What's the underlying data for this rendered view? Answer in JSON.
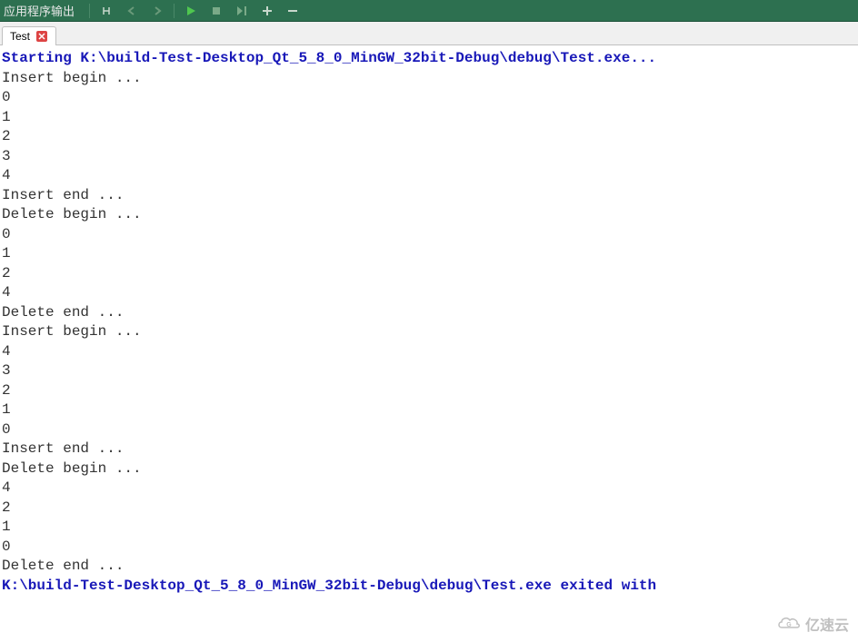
{
  "titleBar": {
    "title": "应用程序输出"
  },
  "tabs": [
    {
      "label": "Test"
    }
  ],
  "console": {
    "lines": [
      {
        "text": "Starting K:\\build-Test-Desktop_Qt_5_8_0_MinGW_32bit-Debug\\debug\\Test.exe...",
        "style": "bold-blue"
      },
      {
        "text": "Insert begin ...",
        "style": "normal"
      },
      {
        "text": "0",
        "style": "normal"
      },
      {
        "text": "1",
        "style": "normal"
      },
      {
        "text": "2",
        "style": "normal"
      },
      {
        "text": "3",
        "style": "normal"
      },
      {
        "text": "4",
        "style": "normal"
      },
      {
        "text": "Insert end ...",
        "style": "normal"
      },
      {
        "text": "Delete begin ...",
        "style": "normal"
      },
      {
        "text": "0",
        "style": "normal"
      },
      {
        "text": "1",
        "style": "normal"
      },
      {
        "text": "2",
        "style": "normal"
      },
      {
        "text": "4",
        "style": "normal"
      },
      {
        "text": "Delete end ...",
        "style": "normal"
      },
      {
        "text": "Insert begin ...",
        "style": "normal"
      },
      {
        "text": "4",
        "style": "normal"
      },
      {
        "text": "3",
        "style": "normal"
      },
      {
        "text": "2",
        "style": "normal"
      },
      {
        "text": "1",
        "style": "normal"
      },
      {
        "text": "0",
        "style": "normal"
      },
      {
        "text": "Insert end ...",
        "style": "normal"
      },
      {
        "text": "Delete begin ...",
        "style": "normal"
      },
      {
        "text": "4",
        "style": "normal"
      },
      {
        "text": "2",
        "style": "normal"
      },
      {
        "text": "1",
        "style": "normal"
      },
      {
        "text": "0",
        "style": "normal"
      },
      {
        "text": "Delete end ...",
        "style": "normal"
      },
      {
        "text": "K:\\build-Test-Desktop_Qt_5_8_0_MinGW_32bit-Debug\\debug\\Test.exe exited with",
        "style": "bold-blue"
      }
    ]
  },
  "watermark": {
    "text": "亿速云"
  }
}
